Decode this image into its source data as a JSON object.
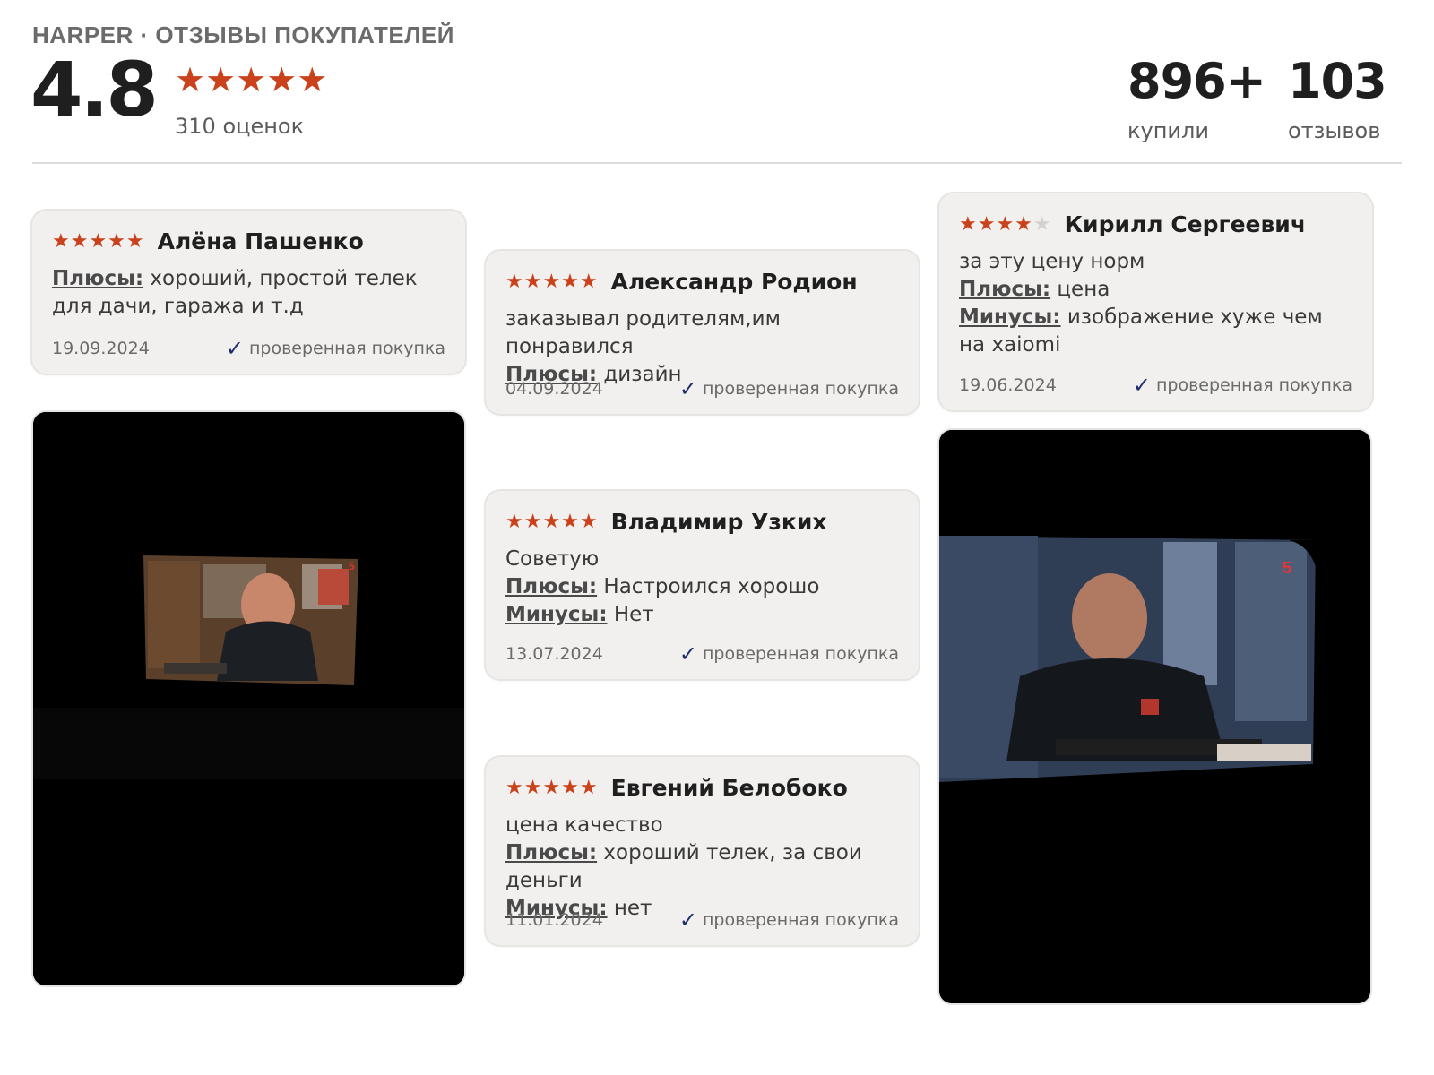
{
  "header": {
    "brand": "HARPER · ОТЗЫВЫ ПОКУПАТЕЛЕЙ",
    "rating": "4.8",
    "stars": "★★★★★",
    "ratings_count": "310 оценок",
    "stats": [
      {
        "value": "896+",
        "label": "купили"
      },
      {
        "value": "103",
        "label": "отзывов"
      }
    ]
  },
  "reviews": [
    {
      "stars": "★★★★★",
      "stars_empty": "",
      "author": "Алёна Пашенко",
      "comment": "",
      "pros_label": "Плюсы:",
      "pros": "хороший, простой телек для дачи, гаража и т.д",
      "cons_label": "",
      "cons": "",
      "date": "19.09.2024",
      "verified": "проверенная покупка"
    },
    {
      "stars": "★★★★★",
      "stars_empty": "",
      "author": "Александр Родион",
      "comment": "заказывал родителям,им понравился",
      "pros_label": "Плюсы:",
      "pros": "дизайн",
      "cons_label": "",
      "cons": "",
      "date": "04.09.2024",
      "verified": "проверенная покупка"
    },
    {
      "stars": "★★★★",
      "stars_empty": "★",
      "author": "Кирилл Сергеевич",
      "comment": "за эту цену норм",
      "pros_label": "Плюсы:",
      "pros": "цена",
      "cons_label": "Минусы:",
      "cons": "изображение хуже чем на xaiomi",
      "date": "19.06.2024",
      "verified": "проверенная покупка"
    },
    {
      "stars": "★★★★★",
      "stars_empty": "",
      "author": "Владимир Узких",
      "comment": "Советую",
      "pros_label": "Плюсы:",
      "pros": "Настроился хорошо",
      "cons_label": "Минусы:",
      "cons": "Нет",
      "date": "13.07.2024",
      "verified": "проверенная покупка"
    },
    {
      "stars": "★★★★★",
      "stars_empty": "",
      "author": "Евгений Белобоко",
      "comment": "цена качество",
      "pros_label": "Плюсы:",
      "pros": "хороший телек, за свои деньги",
      "cons_label": "Минусы:",
      "cons": "нет",
      "date": "11.01.2024",
      "verified": "проверенная покупка"
    }
  ],
  "photos": [
    {
      "icon": "tv-photo-icon",
      "tv_text": "5"
    },
    {
      "icon": "tv-photo-icon",
      "tv_text": "5"
    }
  ],
  "colors": {
    "star": "#c9421c",
    "check": "#1f2f6e",
    "card_bg": "#f1f0ee"
  }
}
